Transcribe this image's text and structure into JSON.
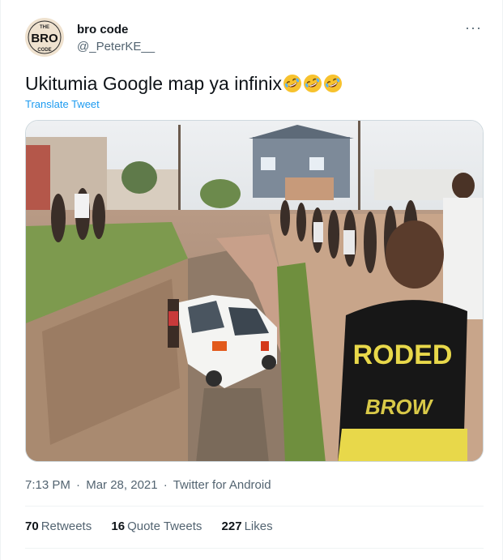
{
  "tweet": {
    "display_name": "bro code",
    "handle": "@_PeterKE__",
    "more_label": "···",
    "text": "Ukitumia Google map ya infinix",
    "emoji_count": 3,
    "emoji_name": "rolling-on-the-floor-laughing-icon",
    "translate_label": "Translate Tweet",
    "time": "7:13 PM",
    "date": "Mar 28, 2021",
    "separator": "·",
    "source": "Twitter for Android",
    "avatar_text": {
      "top": "THE",
      "main": "BRO",
      "bottom": "CODE"
    },
    "photo_text": {
      "shirt_top": "RODED",
      "shirt_bottom": "BROW"
    }
  },
  "stats": {
    "retweets_count": "70",
    "retweets_label": "Retweets",
    "quotes_count": "16",
    "quotes_label": "Quote Tweets",
    "likes_count": "227",
    "likes_label": "Likes"
  },
  "colors": {
    "link": "#1d9bf0",
    "secondary_text": "#536471",
    "primary_text": "#0f1419",
    "divider": "#eff3f4"
  }
}
